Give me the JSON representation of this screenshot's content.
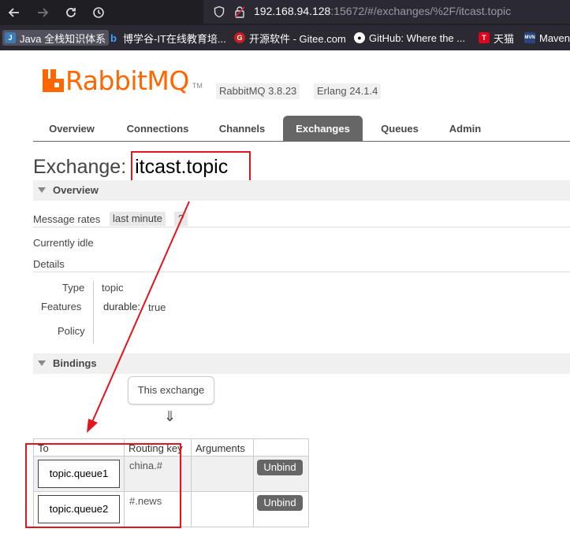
{
  "browser": {
    "url_host": "192.168.94.128",
    "url_rest": ":15672/#/exchanges/%2F/itcast.topic",
    "bookmarks": [
      {
        "label": "Java 全栈知识体系"
      },
      {
        "label": "博学谷-IT在线教育培..."
      },
      {
        "label": "开源软件 - Gitee.com"
      },
      {
        "label": "GitHub: Where the ..."
      },
      {
        "label": "天猫"
      },
      {
        "label": "Maven"
      }
    ]
  },
  "header": {
    "logo": "RabbitMQ",
    "logo_tm": "TM",
    "rabbitmq_version": "RabbitMQ 3.8.23",
    "erlang_version": "Erlang 24.1.4"
  },
  "tabs": [
    {
      "label": "Overview"
    },
    {
      "label": "Connections"
    },
    {
      "label": "Channels"
    },
    {
      "label": "Exchanges",
      "selected": true
    },
    {
      "label": "Queues"
    },
    {
      "label": "Admin"
    }
  ],
  "exchange": {
    "title_prefix": "Exchange:",
    "name": "itcast.topic"
  },
  "overview": {
    "heading": "Overview",
    "message_rates_label": "Message rates",
    "message_rates_range": "last minute",
    "help": "?",
    "status": "Currently idle",
    "details_label": "Details",
    "type_label": "Type",
    "type_value": "topic",
    "features_label": "Features",
    "feature_name": "durable:",
    "feature_value": "true",
    "policy_label": "Policy"
  },
  "bindings": {
    "heading": "Bindings",
    "source_box": "This exchange",
    "arrow": "⇓",
    "columns": [
      "To",
      "Routing key",
      "Arguments"
    ],
    "rows": [
      {
        "to": "topic.queue1",
        "routing_key": "china.#",
        "arguments": "",
        "action": "Unbind"
      },
      {
        "to": "topic.queue2",
        "routing_key": "#.news",
        "arguments": "",
        "action": "Unbind"
      }
    ]
  },
  "colors": {
    "brand": "#ff6600",
    "annotation": "#e5131d",
    "tab_selected": "#666666"
  }
}
